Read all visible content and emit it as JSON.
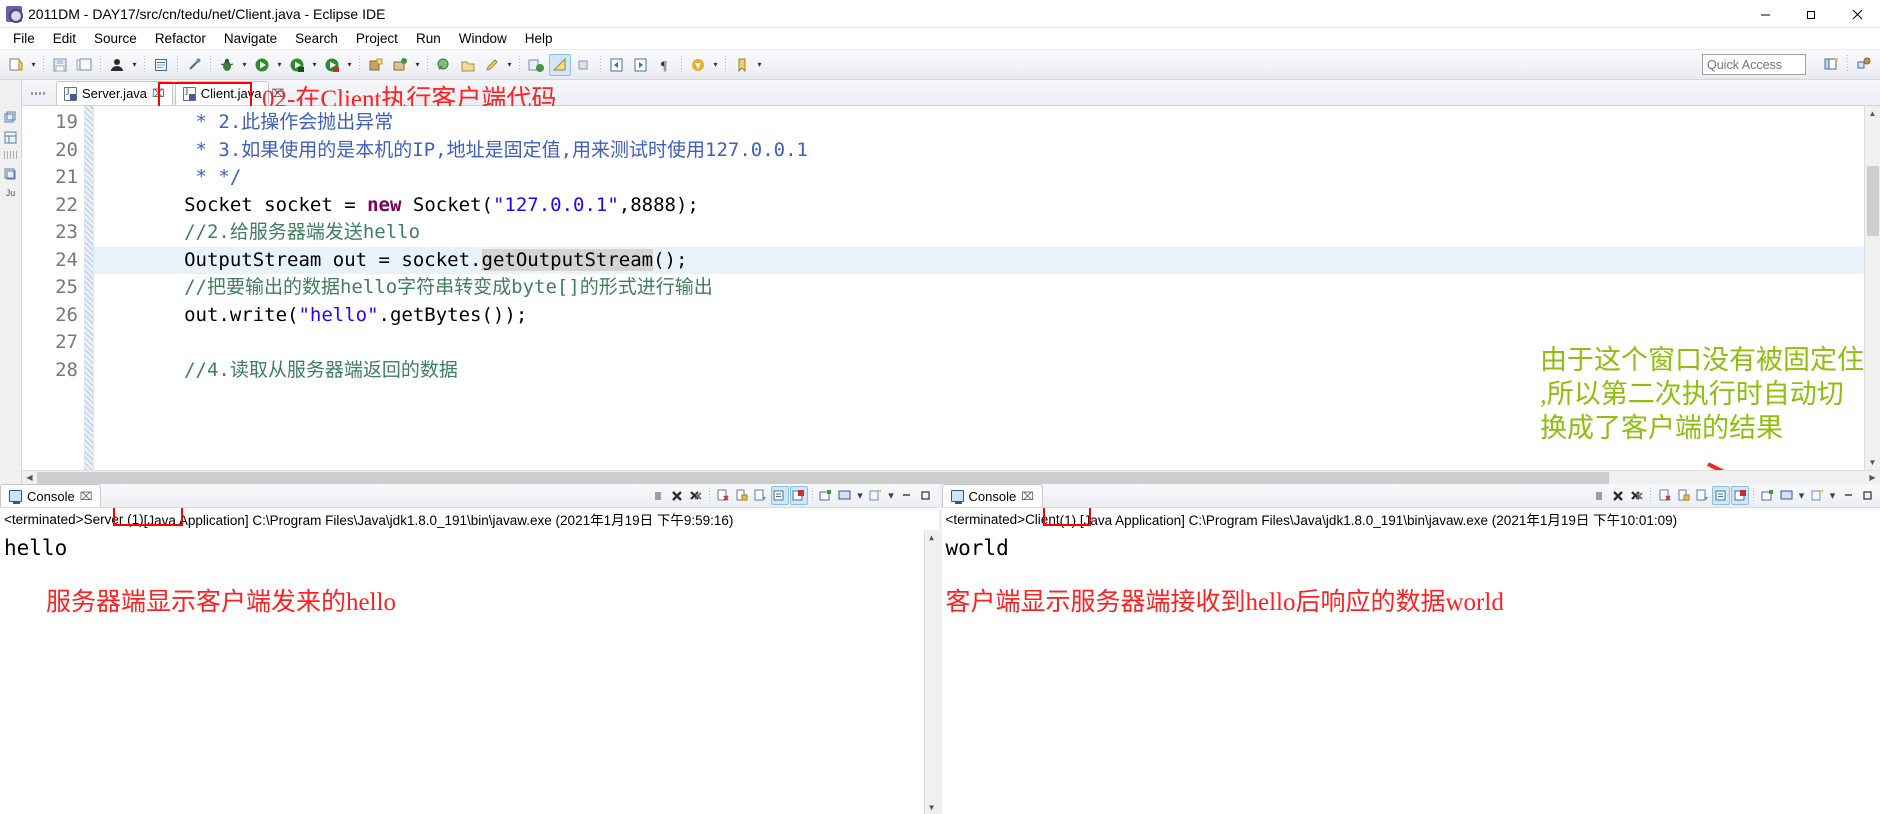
{
  "window": {
    "title": "2011DM - DAY17/src/cn/tedu/net/Client.java - Eclipse IDE",
    "app_icon": "eclipse-icon",
    "minimize": "minimize",
    "restore": "restore",
    "close": "close"
  },
  "menubar": [
    "File",
    "Edit",
    "Source",
    "Refactor",
    "Navigate",
    "Search",
    "Project",
    "Run",
    "Window",
    "Help"
  ],
  "toolbar": {
    "quick_access_placeholder": "Quick Access"
  },
  "editor": {
    "tabs": [
      {
        "label": "Server.java",
        "active": false,
        "close": "⌧"
      },
      {
        "label": "Client.java",
        "active": true,
        "close": "⌧"
      }
    ],
    "tab_annotation": "02-在Client执行客户端代码",
    "annotation_color": "#ff2020",
    "lines": [
      {
        "no": "19",
        "highlight": false,
        "tokens": [
          {
            "t": "        * 2.此操作会抛出异常",
            "c": "jdoc"
          }
        ]
      },
      {
        "no": "20",
        "highlight": false,
        "tokens": [
          {
            "t": "        * 3.如果使用的是本机的IP,地址是固定值,用来测试时使用127.0.0.1",
            "c": "jdoc"
          }
        ]
      },
      {
        "no": "21",
        "highlight": false,
        "tokens": [
          {
            "t": "        * */",
            "c": "jdoc"
          }
        ]
      },
      {
        "no": "22",
        "highlight": false,
        "tokens": [
          {
            "t": "       Socket socket = ",
            "c": "plain"
          },
          {
            "t": "new",
            "c": "k"
          },
          {
            "t": " Socket(",
            "c": "plain"
          },
          {
            "t": "\"127.0.0.1\"",
            "c": "str"
          },
          {
            "t": ",8888);",
            "c": "plain"
          }
        ]
      },
      {
        "no": "23",
        "highlight": false,
        "tokens": [
          {
            "t": "       //2.给服务器端发送hello",
            "c": "cmt"
          }
        ]
      },
      {
        "no": "24",
        "highlight": true,
        "tokens": [
          {
            "t": "       OutputStream out = socket.",
            "c": "plain"
          },
          {
            "t": "getOutputStream",
            "c": "occ"
          },
          {
            "t": "();",
            "c": "plain"
          }
        ]
      },
      {
        "no": "25",
        "highlight": false,
        "tokens": [
          {
            "t": "       //把要输出的数据hello字符串转变成byte[]的形式进行输出",
            "c": "cmt"
          }
        ]
      },
      {
        "no": "26",
        "highlight": false,
        "tokens": [
          {
            "t": "       out.write(",
            "c": "plain"
          },
          {
            "t": "\"hello\"",
            "c": "str"
          },
          {
            "t": ".getBytes());",
            "c": "plain"
          }
        ]
      },
      {
        "no": "27",
        "highlight": false,
        "tokens": [
          {
            "t": "",
            "c": "plain"
          }
        ]
      },
      {
        "no": "28",
        "highlight": false,
        "tokens": [
          {
            "t": "       //4.读取从服务器端返回的数据",
            "c": "cmt"
          }
        ]
      }
    ],
    "right_annotation": "由于这个窗口没有被固定住\n,所以第二次执行时自动切\n换成了客户端的结果",
    "right_annotation_color": "#8fbf0c",
    "arrow_color": "#ff2020"
  },
  "console_left": {
    "tab_label": "Console",
    "tab_close": "⌧",
    "status_prefix": "<terminated> ",
    "status_name": "Server (1)",
    "status_suffix": " [Java Application] C:\\Program Files\\Java\\jdk1.8.0_191\\bin\\javaw.exe (2021年1月19日 下午9:59:16)",
    "output": "hello",
    "annotation": "服务器端显示客户端发来的hello",
    "annotation_color": "#ff2020"
  },
  "console_right": {
    "tab_label": "Console",
    "tab_close": "⌧",
    "status_prefix": "<terminated> ",
    "status_name": "Client",
    "status_suffix": " (1) [Java Application] C:\\Program Files\\Java\\jdk1.8.0_191\\bin\\javaw.exe (2021年1月19日 下午10:01:09)",
    "output": "world",
    "annotation": "客户端显示服务器端接收到hello后响应的数据world",
    "annotation_color": "#ff2020"
  }
}
